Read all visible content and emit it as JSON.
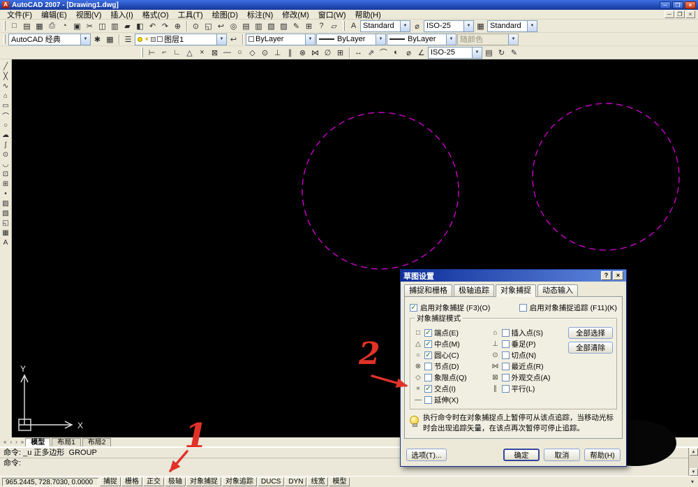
{
  "ui": {
    "logo_letter": "A",
    "combo_arrow": "▼",
    "sun": "☀",
    "scroll_up": "▲",
    "scroll_down": "▼"
  },
  "window": {
    "title": "AutoCAD 2007 - [Drawing1.dwg]",
    "controls": [
      {
        "name": "minimize-button",
        "glyph": "─"
      },
      {
        "name": "maximize-button",
        "glyph": "❐"
      },
      {
        "name": "close-button",
        "glyph": "×"
      }
    ]
  },
  "menubar": {
    "items": [
      {
        "name": "menu-file",
        "label": "文件(F)"
      },
      {
        "name": "menu-edit",
        "label": "编辑(E)"
      },
      {
        "name": "menu-view",
        "label": "视图(V)"
      },
      {
        "name": "menu-insert",
        "label": "插入(I)"
      },
      {
        "name": "menu-format",
        "label": "格式(O)"
      },
      {
        "name": "menu-tools",
        "label": "工具(T)"
      },
      {
        "name": "menu-draw",
        "label": "绘图(D)"
      },
      {
        "name": "menu-dimension",
        "label": "标注(N)"
      },
      {
        "name": "menu-modify",
        "label": "修改(M)"
      },
      {
        "name": "menu-window",
        "label": "窗口(W)"
      },
      {
        "name": "menu-help",
        "label": "帮助(H)"
      }
    ],
    "doc_controls": [
      {
        "name": "doc-minimize-button",
        "glyph": "─"
      },
      {
        "name": "doc-restore-button",
        "glyph": "❐"
      },
      {
        "name": "doc-close-button",
        "glyph": "×"
      }
    ]
  },
  "toolbar1": {
    "group1": [
      {
        "name": "new-icon",
        "glyph": "□"
      },
      {
        "name": "open-icon",
        "glyph": "▤"
      },
      {
        "name": "save-icon",
        "glyph": "▦"
      },
      {
        "name": "plot-icon",
        "glyph": "⎙"
      },
      {
        "name": "plot-preview-icon",
        "glyph": "◔"
      },
      {
        "name": "publish-icon",
        "glyph": "▣"
      },
      {
        "name": "cut-icon",
        "glyph": "✂"
      },
      {
        "name": "copy-icon",
        "glyph": "◫"
      },
      {
        "name": "paste-icon",
        "glyph": "▥"
      },
      {
        "name": "match-properties-icon",
        "glyph": "▰"
      },
      {
        "name": "block-editor-icon",
        "glyph": "◧"
      },
      {
        "name": "undo-icon",
        "glyph": "↶"
      },
      {
        "name": "redo-icon",
        "glyph": "↷"
      },
      {
        "name": "pan-icon",
        "glyph": "⊕"
      }
    ],
    "group2": [
      {
        "name": "zoom-realtime-icon",
        "glyph": "⊙"
      },
      {
        "name": "zoom-window-icon",
        "glyph": "◱"
      },
      {
        "name": "zoom-previous-icon",
        "glyph": "↩"
      },
      {
        "name": "orbit-icon",
        "glyph": "◎"
      },
      {
        "name": "properties-icon",
        "glyph": "▤"
      },
      {
        "name": "designcenter-icon",
        "glyph": "▥"
      },
      {
        "name": "tool-palettes-icon",
        "glyph": "▧"
      },
      {
        "name": "sheetset-manager-icon",
        "glyph": "▨"
      },
      {
        "name": "markup-manager-icon",
        "glyph": "✎"
      },
      {
        "name": "quickcalc-icon",
        "glyph": "⊞"
      },
      {
        "name": "help-icon",
        "glyph": "?"
      },
      {
        "name": "named-views-icon",
        "glyph": "▱"
      }
    ],
    "styles": [
      {
        "icon_name": "text-style-icon",
        "icon": "A",
        "combo_name": "text-style-combo",
        "value": "Standard"
      },
      {
        "icon_name": "dim-style-icon",
        "icon": "⌀",
        "combo_name": "dim-style-combo",
        "value": "ISO-25"
      },
      {
        "icon_name": "table-style-icon",
        "icon": "▦",
        "combo_name": "table-style-combo",
        "value": "Standard"
      }
    ]
  },
  "toolbar2": {
    "workspace_value": "AutoCAD 经典",
    "icons_a": [
      {
        "name": "gear-icon",
        "glyph": "✱"
      },
      {
        "name": "save-workspace-icon",
        "glyph": "▦"
      }
    ],
    "layer_properties_glyph": "☰",
    "layer": {
      "name": "图层1"
    },
    "layer_previous_glyph": "↩",
    "color_value": "ByLayer",
    "linetype_value": "ByLayer",
    "lineweight_value": "ByLayer",
    "plotstyle_value": "随颜色"
  },
  "toolbar3": {
    "osnap_icons": [
      {
        "name": "track-point-icon",
        "glyph": "⊢"
      },
      {
        "name": "snap-from-icon",
        "glyph": "⌐"
      },
      {
        "name": "snap-endpoint-icon",
        "glyph": "∟"
      },
      {
        "name": "snap-midpoint-icon",
        "glyph": "△"
      },
      {
        "name": "snap-intersection-icon",
        "glyph": "×"
      },
      {
        "name": "snap-apparent-icon",
        "glyph": "⊠"
      },
      {
        "name": "snap-extension-icon",
        "glyph": "―"
      },
      {
        "name": "snap-center-icon",
        "glyph": "○"
      },
      {
        "name": "snap-quadrant-icon",
        "glyph": "◇"
      },
      {
        "name": "snap-tangent-icon",
        "glyph": "⊙"
      },
      {
        "name": "snap-perpendicular-icon",
        "glyph": "⊥"
      },
      {
        "name": "snap-parallel-icon",
        "glyph": "∥"
      },
      {
        "name": "snap-node-icon",
        "glyph": "⊗"
      },
      {
        "name": "snap-nearest-icon",
        "glyph": "⋈"
      },
      {
        "name": "snap-none-icon",
        "glyph": "∅"
      },
      {
        "name": "osnap-settings-icon",
        "glyph": "⊞"
      }
    ],
    "dim_icons": [
      {
        "name": "dim-linear-icon",
        "glyph": "↔"
      },
      {
        "name": "dim-aligned-icon",
        "glyph": "⇗"
      },
      {
        "name": "dim-arc-icon",
        "glyph": "⌒"
      },
      {
        "name": "dim-radius-icon",
        "glyph": "◐"
      },
      {
        "name": "dim-diameter-icon",
        "glyph": "⌀"
      },
      {
        "name": "dim-angular-icon",
        "glyph": "∠"
      }
    ],
    "dim_style_value": "ISO-25",
    "extra_icons": [
      {
        "name": "dim-style-manager-icon",
        "glyph": "▤"
      },
      {
        "name": "dim-update-icon",
        "glyph": "↻"
      },
      {
        "name": "dim-edit-icon",
        "glyph": "✎"
      }
    ]
  },
  "draw_toolbar": {
    "icons": [
      {
        "name": "line-icon",
        "glyph": "╱"
      },
      {
        "name": "construction-line-icon",
        "glyph": "╳"
      },
      {
        "name": "polyline-icon",
        "glyph": "∿"
      },
      {
        "name": "polygon-icon",
        "glyph": "⌂"
      },
      {
        "name": "rectangle-icon",
        "glyph": "▭"
      },
      {
        "name": "arc-icon",
        "glyph": "⌒"
      },
      {
        "name": "circle-icon",
        "glyph": "○"
      },
      {
        "name": "revcloud-icon",
        "glyph": "☁"
      },
      {
        "name": "spline-icon",
        "glyph": "∫"
      },
      {
        "name": "ellipse-icon",
        "glyph": "⊙"
      },
      {
        "name": "ellipse-arc-icon",
        "glyph": "◡"
      },
      {
        "name": "insert-block-icon",
        "glyph": "⊡"
      },
      {
        "name": "make-block-icon",
        "glyph": "⊞"
      },
      {
        "name": "point-icon",
        "glyph": "•"
      },
      {
        "name": "hatch-icon",
        "glyph": "▨"
      },
      {
        "name": "gradient-icon",
        "glyph": "▧"
      },
      {
        "name": "region-icon",
        "glyph": "◱"
      },
      {
        "name": "table-icon",
        "glyph": "▦"
      },
      {
        "name": "mtext-icon",
        "glyph": "A"
      }
    ]
  },
  "canvas": {
    "circle_color": "#cc00cc",
    "axis_labels": {
      "x": "X",
      "y": "Y"
    }
  },
  "dialog": {
    "title": "草图设置",
    "help_glyph": "?",
    "close_glyph": "×",
    "tabs": [
      {
        "name": "tab-snap-and-grid",
        "label": "捕捉和栅格",
        "active": false
      },
      {
        "name": "tab-polar-tracking",
        "label": "极轴追踪",
        "active": false
      },
      {
        "name": "tab-object-snap",
        "label": "对象捕捉",
        "active": true
      },
      {
        "name": "tab-dynamic-input",
        "label": "动态输入",
        "active": false
      }
    ],
    "enable_osnap": {
      "label": "启用对象捕捉 (F3)(O)",
      "checked": true
    },
    "enable_otrack": {
      "label": "启用对象捕捉追踪 (F11)(K)",
      "checked": false
    },
    "group_label": "对象捕捉模式",
    "modes_left": [
      {
        "glyph": "□",
        "label": "端点(E)",
        "checked": true
      },
      {
        "glyph": "△",
        "label": "中点(M)",
        "checked": true
      },
      {
        "glyph": "○",
        "label": "圆心(C)",
        "checked": true
      },
      {
        "glyph": "⊗",
        "label": "节点(D)",
        "checked": false
      },
      {
        "glyph": "◇",
        "label": "象限点(Q)",
        "checked": false
      },
      {
        "glyph": "×",
        "label": "交点(I)",
        "checked": true
      },
      {
        "glyph": "―",
        "label": "延伸(X)",
        "checked": false
      }
    ],
    "modes_right": [
      {
        "glyph": "⌂",
        "label": "插入点(S)",
        "checked": false
      },
      {
        "glyph": "⊥",
        "label": "垂足(P)",
        "checked": false
      },
      {
        "glyph": "⊙",
        "label": "切点(N)",
        "checked": false
      },
      {
        "glyph": "⋈",
        "label": "最近点(R)",
        "checked": false
      },
      {
        "glyph": "⊠",
        "label": "外观交点(A)",
        "checked": false
      },
      {
        "glyph": "∥",
        "label": "平行(L)",
        "checked": false
      }
    ],
    "select_all": "全部选择",
    "clear_all": "全部清除",
    "tip": "执行命令时在对象捕捉点上暂停可从该点追踪，当移动光标时会出现追踪矢量，在该点再次暂停可停止追踪。",
    "options_button": "选项(T)...",
    "ok": "确定",
    "cancel": "取消",
    "help": "帮助(H)"
  },
  "model_tabs": {
    "nav": [
      {
        "name": "first-tab-icon",
        "glyph": "«"
      },
      {
        "name": "prev-tab-icon",
        "glyph": "‹"
      },
      {
        "name": "next-tab-icon",
        "glyph": "›"
      },
      {
        "name": "last-tab-icon",
        "glyph": "»"
      }
    ],
    "tabs": [
      {
        "name": "tab-model",
        "label": "模型",
        "active": true
      },
      {
        "name": "tab-layout1",
        "label": "布局1",
        "active": false
      },
      {
        "name": "tab-layout2",
        "label": "布局2",
        "active": false
      }
    ]
  },
  "command": {
    "lines": [
      {
        "text": "命令: _u 正多边形  GROUP"
      },
      {
        "text": "命令:"
      }
    ]
  },
  "statusbar": {
    "coords": "965.2445, 728.7030, 0.0000",
    "buttons": [
      {
        "name": "status-snap-button",
        "label": "捕捉",
        "active": false
      },
      {
        "name": "status-grid-button",
        "label": "栅格",
        "active": false
      },
      {
        "name": "status-ortho-button",
        "label": "正交",
        "active": false
      },
      {
        "name": "status-polar-button",
        "label": "极轴",
        "active": false
      },
      {
        "name": "status-osnap-button",
        "label": "对象捕捉",
        "active": false
      },
      {
        "name": "status-otrack-button",
        "label": "对象追踪",
        "active": false
      },
      {
        "name": "status-ducs-button",
        "label": "DUCS",
        "active": false
      },
      {
        "name": "status-dyn-button",
        "label": "DYN",
        "active": false
      },
      {
        "name": "status-lwt-button",
        "label": "线宽",
        "active": false
      },
      {
        "name": "status-model-button",
        "label": "模型",
        "active": false
      }
    ],
    "tray": "▾"
  },
  "annotations": {
    "step1": "1",
    "step2": "2",
    "color": "#e03228"
  }
}
